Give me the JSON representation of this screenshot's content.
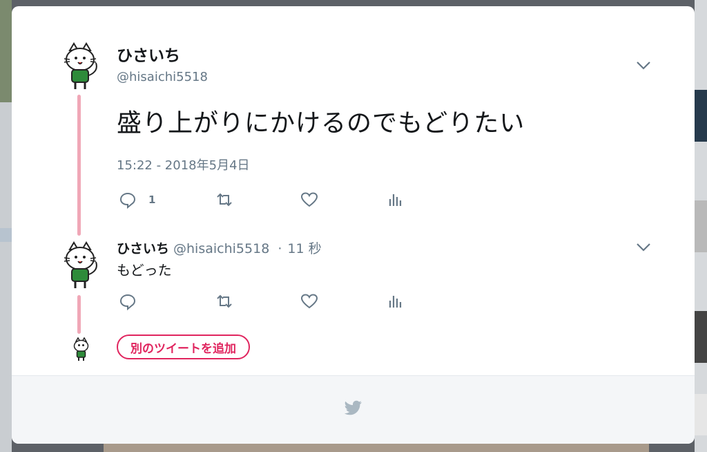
{
  "tweet": {
    "display_name": "ひさいち",
    "handle": "@hisaichi5518",
    "text": "盛り上がりにかけるのでもどりたい",
    "timestamp": "15:22 - 2018年5月4日",
    "reply_count": "1"
  },
  "reply": {
    "display_name": "ひさいち",
    "handle": "@hisaichi5518",
    "separator": "·",
    "age": "11 秒",
    "text": "もどった"
  },
  "add_tweet_label": "別のツイートを追加",
  "colors": {
    "thread_line": "#f0a7b7",
    "accent": "#e0245e",
    "secondary_text": "#657786",
    "footer_bg": "#f4f6f8"
  },
  "icons": [
    "reply-icon",
    "retweet-icon",
    "like-icon",
    "analytics-icon",
    "chevron-down-icon",
    "twitter-bird-icon",
    "avatar"
  ]
}
